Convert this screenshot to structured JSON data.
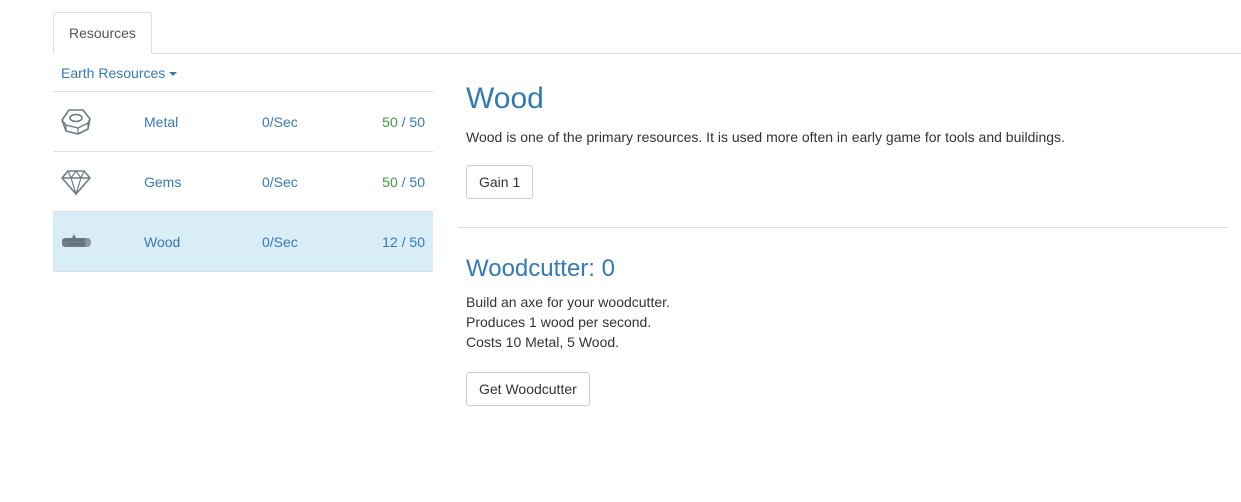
{
  "tabs": [
    {
      "label": "Resources",
      "active": true
    }
  ],
  "resource_panel": {
    "dropdown_label": "Earth Resources",
    "rows": [
      {
        "icon": "hex-nut-icon",
        "name": "Metal",
        "rate": "0/Sec",
        "current": "50",
        "separator": " / ",
        "max": "50",
        "full": true
      },
      {
        "icon": "gem-icon",
        "name": "Gems",
        "rate": "0/Sec",
        "current": "50",
        "separator": " / ",
        "max": "50",
        "full": true
      },
      {
        "icon": "log-icon",
        "name": "Wood",
        "rate": "0/Sec",
        "current": "12",
        "separator": " / ",
        "max": "50",
        "full": false,
        "selected": true
      }
    ]
  },
  "detail": {
    "title": "Wood",
    "description": "Wood is one of the primary resources. It is used more often in early game for tools and buildings.",
    "gain_button": "Gain 1"
  },
  "worker": {
    "title": "Woodcutter: 0",
    "lines": [
      "Build an axe for your woodcutter.",
      "Produces 1 wood per second.",
      "Costs 10 Metal, 5 Wood."
    ],
    "button": "Get Woodcutter"
  },
  "colors": {
    "link": "#337ab7",
    "full_amount": "#3c9a3c",
    "selected_row": "#d9edf7",
    "icon_gray": "#6d7b85"
  }
}
